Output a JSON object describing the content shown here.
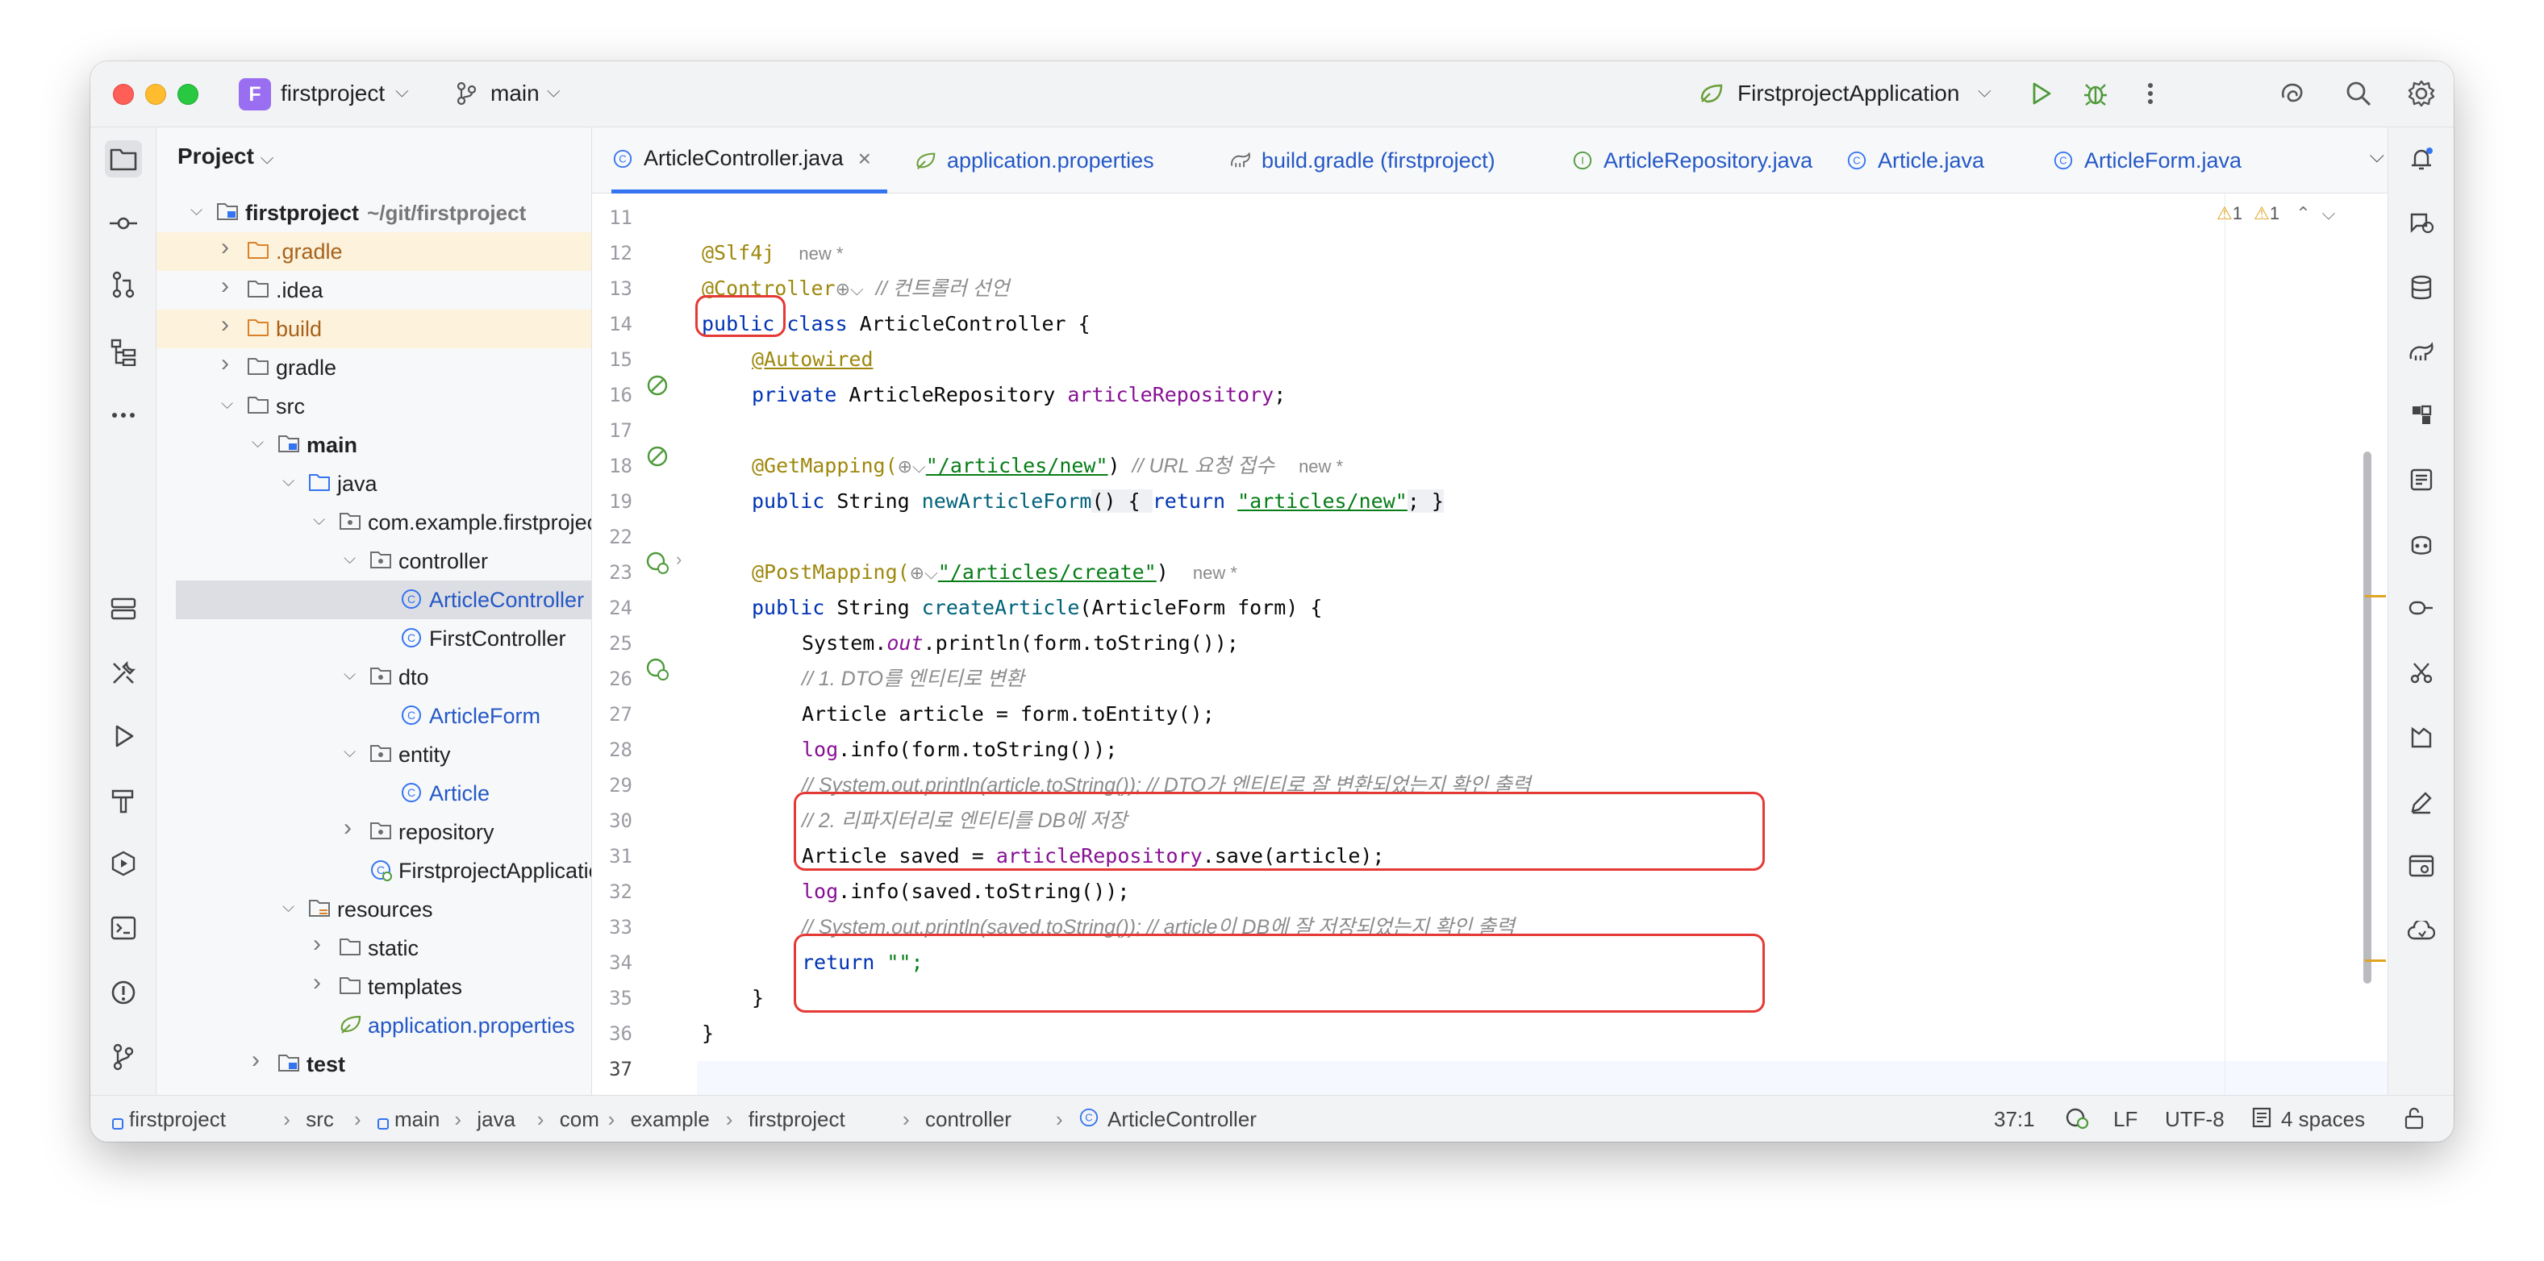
{
  "titlebar": {
    "project_badge": "F",
    "project_name": "firstproject",
    "branch": "main",
    "run_config": "FirstprojectApplication"
  },
  "project_panel": {
    "title": "Project",
    "tree": [
      {
        "label": "firstproject",
        "suffix": "~/git/firstproject",
        "depth": 0,
        "expanded": true,
        "type": "module",
        "bold": true
      },
      {
        "label": ".gradle",
        "depth": 1,
        "expanded": false,
        "type": "folder-orange",
        "highlight": true
      },
      {
        "label": ".idea",
        "depth": 1,
        "expanded": false,
        "type": "folder"
      },
      {
        "label": "build",
        "depth": 1,
        "expanded": false,
        "type": "folder-orange",
        "highlight": true
      },
      {
        "label": "gradle",
        "depth": 1,
        "expanded": false,
        "type": "folder"
      },
      {
        "label": "src",
        "depth": 1,
        "expanded": true,
        "type": "folder"
      },
      {
        "label": "main",
        "depth": 2,
        "expanded": true,
        "type": "module",
        "bold": true
      },
      {
        "label": "java",
        "depth": 3,
        "expanded": true,
        "type": "folder-blue"
      },
      {
        "label": "com.example.firstproject",
        "depth": 4,
        "expanded": true,
        "type": "package"
      },
      {
        "label": "controller",
        "depth": 5,
        "expanded": true,
        "type": "package"
      },
      {
        "label": "ArticleController",
        "depth": 6,
        "type": "class",
        "selected": true,
        "blue": true
      },
      {
        "label": "FirstController",
        "depth": 6,
        "type": "class"
      },
      {
        "label": "dto",
        "depth": 5,
        "expanded": true,
        "type": "package"
      },
      {
        "label": "ArticleForm",
        "depth": 6,
        "type": "class",
        "blue": true
      },
      {
        "label": "entity",
        "depth": 5,
        "expanded": true,
        "type": "package"
      },
      {
        "label": "Article",
        "depth": 6,
        "type": "class",
        "blue": true
      },
      {
        "label": "repository",
        "depth": 5,
        "expanded": false,
        "type": "package"
      },
      {
        "label": "FirstprojectApplication",
        "depth": 5,
        "type": "spring-class"
      },
      {
        "label": "resources",
        "depth": 3,
        "expanded": true,
        "type": "folder-res"
      },
      {
        "label": "static",
        "depth": 4,
        "expanded": false,
        "type": "folder"
      },
      {
        "label": "templates",
        "depth": 4,
        "expanded": false,
        "type": "folder"
      },
      {
        "label": "application.properties",
        "depth": 4,
        "type": "properties",
        "blue": true
      },
      {
        "label": "test",
        "depth": 2,
        "expanded": false,
        "type": "module",
        "bold": true
      }
    ]
  },
  "tabs": [
    {
      "label": "ArticleController.java",
      "icon": "class-icon",
      "active": true,
      "closable": true
    },
    {
      "label": "application.properties",
      "icon": "properties-icon",
      "blue": true
    },
    {
      "label": "build.gradle (firstproject)",
      "icon": "gradle-icon",
      "blue": true
    },
    {
      "label": "ArticleRepository.java",
      "icon": "interface-icon",
      "blue": true
    },
    {
      "label": "Article.java",
      "icon": "class-icon",
      "blue": true
    },
    {
      "label": "ArticleForm.java",
      "icon": "class-icon",
      "blue": true
    }
  ],
  "editor": {
    "inspections": {
      "warnings": "1",
      "weak_warnings": "1"
    },
    "line_numbers": [
      "11",
      "12",
      "13",
      "14",
      "15",
      "16",
      "17",
      "18",
      "19",
      "22",
      "23",
      "24",
      "25",
      "26",
      "27",
      "28",
      "29",
      "30",
      "31",
      "32",
      "33",
      "34",
      "35",
      "36",
      "37"
    ]
  },
  "code": {
    "slf4j": "@Slf4j",
    "new_marker": "new *",
    "controller_ann": "@Controller",
    "controller_comment": "// 컨트롤러 선언",
    "class_decl_kw": "public class",
    "class_name": " ArticleController {",
    "autowired": "@Autowired",
    "private_kw": "private",
    "repo_type": " ArticleRepository ",
    "repo_field": "articleRepository",
    "semicolon": ";",
    "getmapping": "@GetMapping(",
    "getmapping_path": "\"/articles/new\"",
    "getmapping_close": ")",
    "getmapping_comment": "// URL 요청 접수",
    "public_kw": "public",
    "string_type": " String ",
    "newform_method": "newArticleForm",
    "newform_body_open": "() { ",
    "return_kw": "return",
    "newform_ret": "\"articles/new\"",
    "newform_body_close": "; }",
    "postmapping": "@PostMapping(",
    "postmapping_path": "\"/articles/create\"",
    "postmapping_close": ")",
    "create_method": "createArticle",
    "create_params": "(ArticleForm form) {",
    "sysout_1": "System.",
    "sysout_out": "out",
    "sysout_2": ".println(form.toString());",
    "comment_1": "// 1. DTO를 엔티티로 변환",
    "line_toentity": "Article article = form.toEntity();",
    "log_kw": "log",
    "log_form": ".info(form.toString());",
    "comment_sysout_article": "// System.out.println(article.toString()); // DTO가 엔티티로 잘 변환되었는지 확인 출력",
    "comment_2": "// 2. 리파지터리로 엔티티를 DB에 저장",
    "saved_1": "Article saved = ",
    "saved_2": ".save(article);",
    "log_saved": ".info(saved.toString());",
    "comment_sysout_saved": "// System.out.println(saved.toString()); // article이 DB에 잘 저장되었는지 확인 출력",
    "return_empty": " \"\";",
    "close_brace": "}"
  },
  "statusbar": {
    "breadcrumbs": [
      "firstproject",
      "src",
      "main",
      "java",
      "com",
      "example",
      "firstproject",
      "controller",
      "ArticleController"
    ],
    "position": "37:1",
    "line_sep": "LF",
    "encoding": "UTF-8",
    "indent": "4 spaces"
  },
  "colors": {
    "accent": "#3574f0",
    "highlight_box": "#e53935",
    "folder_orange_bg": "#fdf2dc"
  }
}
